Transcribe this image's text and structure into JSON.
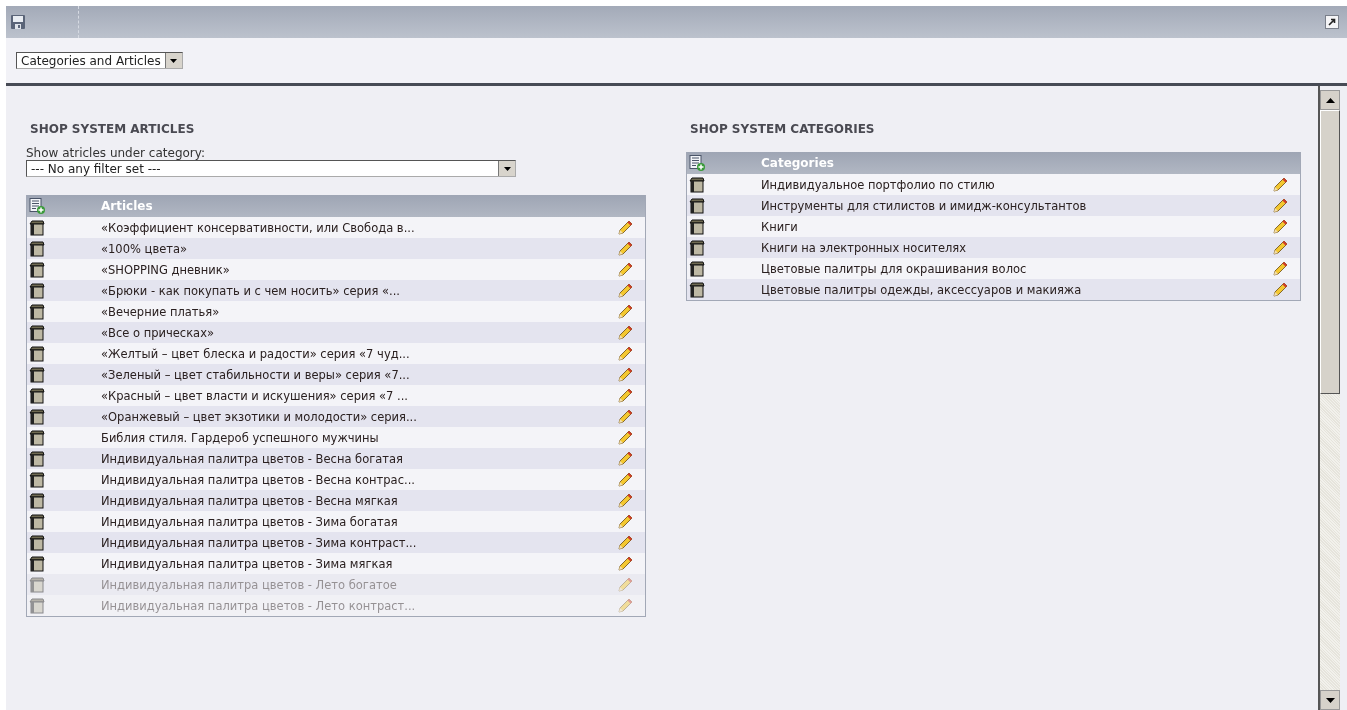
{
  "view_select": {
    "value": "Categories and Articles"
  },
  "articles_panel": {
    "heading": "SHOP SYSTEM ARTICLES",
    "filter_label": "Show atricles under category:",
    "filter_value": "--- No any filter set ---",
    "column": "Articles",
    "rows": [
      {
        "title": "«Коэффициент консервативности, или Свобода в...",
        "faded": false
      },
      {
        "title": "«100% цвета»",
        "faded": false
      },
      {
        "title": "«SHOPPING дневник»",
        "faded": false
      },
      {
        "title": "«Брюки - как покупать и с чем носить» серия «...",
        "faded": false
      },
      {
        "title": "«Вечерние платья»",
        "faded": false
      },
      {
        "title": "«Все о прическах»",
        "faded": false
      },
      {
        "title": "«Желтый – цвет блеска и радости» серия «7 чуд...",
        "faded": false
      },
      {
        "title": "«Зеленый – цвет стабильности и веры» серия «7...",
        "faded": false
      },
      {
        "title": "«Красный – цвет власти и искушения» серия «7 ...",
        "faded": false
      },
      {
        "title": "«Оранжевый – цвет экзотики и молодости» серия...",
        "faded": false
      },
      {
        "title": "Библия стиля. Гардероб успешного мужчины",
        "faded": false
      },
      {
        "title": "Индивидуальная палитра цветов - Весна богатая",
        "faded": false
      },
      {
        "title": "Индивидуальная палитра цветов - Весна контрас...",
        "faded": false
      },
      {
        "title": "Индивидуальная палитра цветов - Весна мягкая",
        "faded": false
      },
      {
        "title": "Индивидуальная палитра цветов - Зима богатая",
        "faded": false
      },
      {
        "title": "Индивидуальная палитра цветов - Зима контраст...",
        "faded": false
      },
      {
        "title": "Индивидуальная палитра цветов - Зима мягкая",
        "faded": false
      },
      {
        "title": "Индивидуальная палитра цветов - Лето богатое",
        "faded": true
      },
      {
        "title": "Индивидуальная палитра цветов - Лето контраст...",
        "faded": true
      }
    ]
  },
  "categories_panel": {
    "heading": "SHOP SYSTEM CATEGORIES",
    "column": "Categories",
    "rows": [
      {
        "title": "Индивидуальное портфолио по стилю"
      },
      {
        "title": "Инструменты для стилистов и имидж-консультантов"
      },
      {
        "title": "Книги"
      },
      {
        "title": "Книги на электронных носителях"
      },
      {
        "title": "Цветовые палитры для окрашивания волос"
      },
      {
        "title": "Цветовые палитры одежды, аксессуаров и макияжа"
      }
    ]
  }
}
